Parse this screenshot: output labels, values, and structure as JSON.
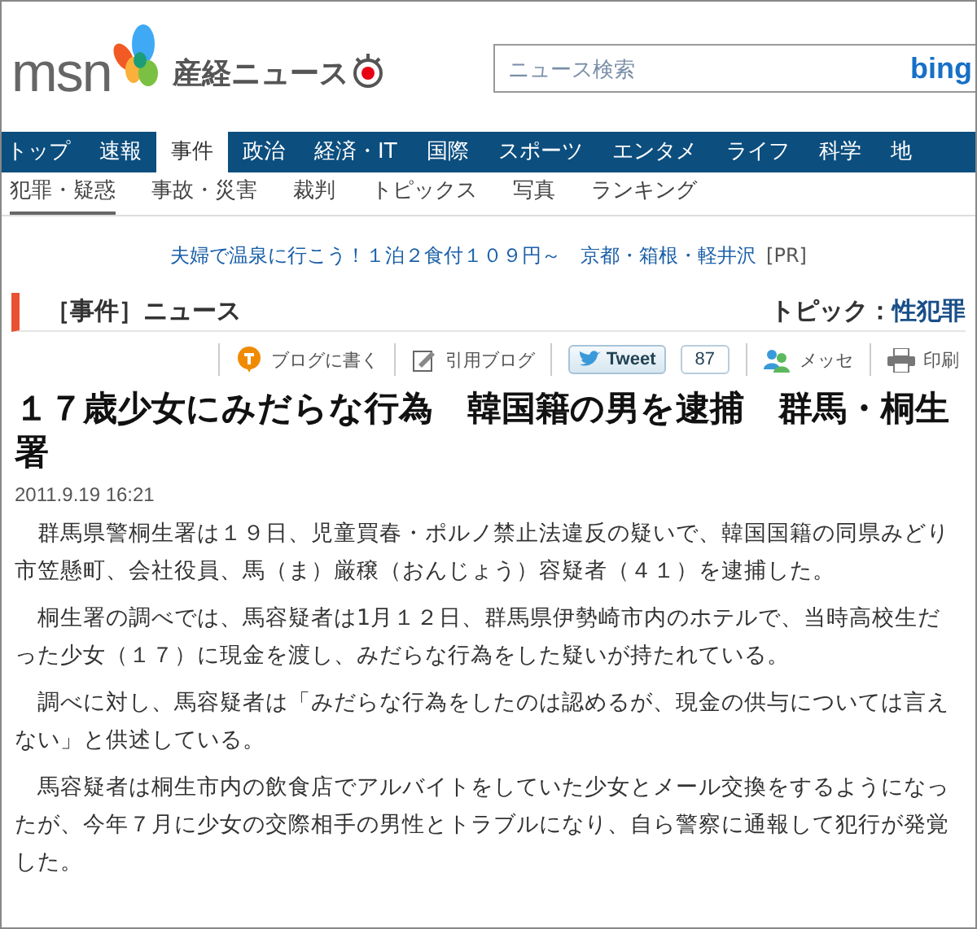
{
  "header": {
    "brand": "msn",
    "site": "産経ニュース",
    "search": {
      "placeholder": "ニュース検索",
      "engine": "bing"
    }
  },
  "nav": {
    "tabs": [
      {
        "label": "トップ",
        "selected": false
      },
      {
        "label": "速報",
        "selected": false
      },
      {
        "label": "事件",
        "selected": true
      },
      {
        "label": "政治",
        "selected": false
      },
      {
        "label": "経済・IT",
        "selected": false
      },
      {
        "label": "国際",
        "selected": false
      },
      {
        "label": "スポーツ",
        "selected": false
      },
      {
        "label": "エンタメ",
        "selected": false
      },
      {
        "label": "ライフ",
        "selected": false
      },
      {
        "label": "科学",
        "selected": false
      },
      {
        "label": "地",
        "selected": false
      }
    ],
    "subtabs": [
      {
        "label": "犯罪・疑惑",
        "selected": true
      },
      {
        "label": "事故・災害",
        "selected": false
      },
      {
        "label": "裁判",
        "selected": false
      },
      {
        "label": "トピックス",
        "selected": false
      },
      {
        "label": "写真",
        "selected": false
      },
      {
        "label": "ランキング",
        "selected": false
      }
    ]
  },
  "ad": {
    "text": "夫婦で温泉に行こう！１泊２食付１０９円～　京都・箱根・軽井沢",
    "tag": "[PR]"
  },
  "section": {
    "title": "［事件］ニュース",
    "topic_label": "トピック：",
    "topic": "性犯罪"
  },
  "toolbar": [
    {
      "kind": "blog",
      "label": "ブログに書く"
    },
    {
      "kind": "quote",
      "label": "引用ブログ"
    },
    {
      "kind": "tweet",
      "label": "Tweet",
      "count": "87"
    },
    {
      "kind": "messe",
      "label": "メッセ"
    },
    {
      "kind": "print",
      "label": "印刷"
    }
  ],
  "article": {
    "title": "１７歳少女にみだらな行為　韓国籍の男を逮捕　群馬・桐生署",
    "date": "2011.9.19 16:21",
    "paragraphs": [
      "　群馬県警桐生署は１９日、児童買春・ポルノ禁止法違反の疑いで、韓国国籍の同県みどり市笠懸町、会社役員、馬（ま）厳穣（おんじょう）容疑者（４１）を逮捕した。",
      "　桐生署の調べでは、馬容疑者は1月１２日、群馬県伊勢崎市内のホテルで、当時高校生だった少女（１７）に現金を渡し、みだらな行為をした疑いが持たれている。",
      "　調べに対し、馬容疑者は「みだらな行為をしたのは認めるが、現金の供与については言えない」と供述している。",
      "　馬容疑者は桐生市内の飲食店でアルバイトをしていた少女とメール交換をするようになったが、今年７月に少女の交際相手の男性とトラブルになり、自ら警察に通報して犯行が発覚した。"
    ]
  }
}
